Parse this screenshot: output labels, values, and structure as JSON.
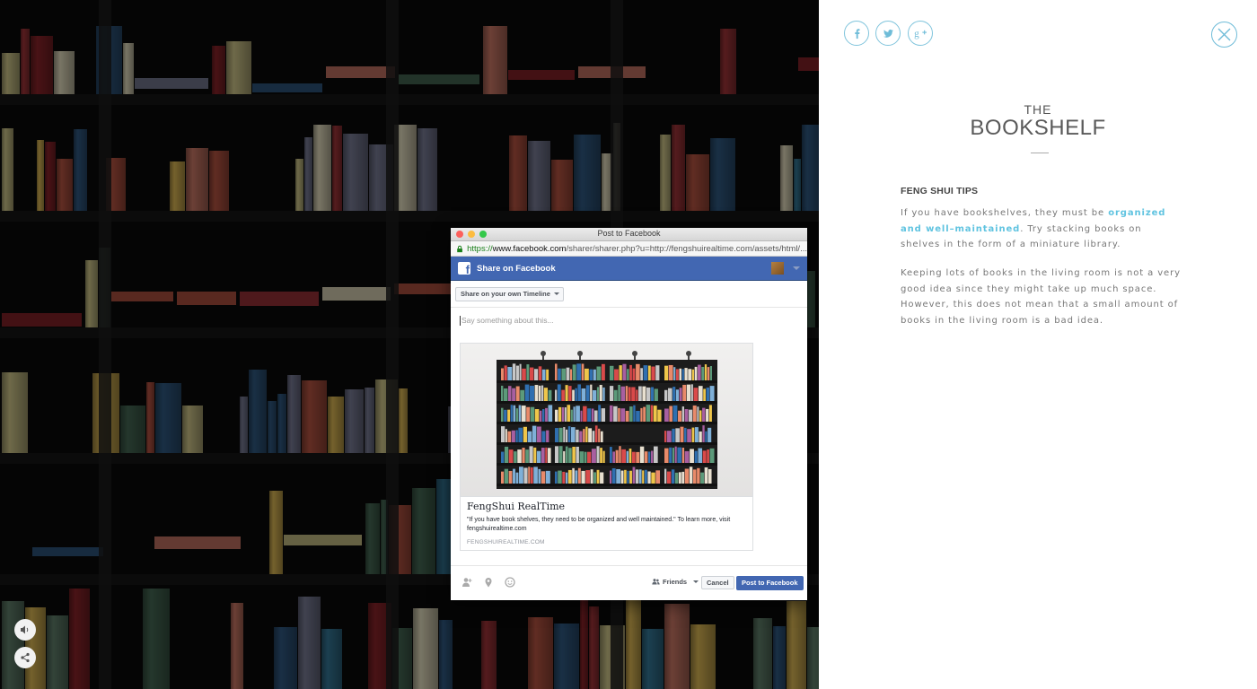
{
  "scene": {
    "controls": [
      {
        "name": "sound-icon"
      },
      {
        "name": "share-icon"
      }
    ]
  },
  "popup": {
    "window_title": "Post to Facebook",
    "url_secure": "https://",
    "url_domain": "www.facebook.com",
    "url_rest": "/sharer/sharer.php?u=http://fengshuirealtime.com/assets/html/...",
    "header_title": "Share on Facebook",
    "share_target": "Share on your own Timeline",
    "compose_placeholder": "Say something about this...",
    "card": {
      "title": "FengShui RealTime",
      "description": "\"If you have book shelves, they need to be organized and well maintained.\" To learn more, visit fengshuirealtime.com",
      "domain": "FENGSHUIREALTIME.COM"
    },
    "audience": "Friends",
    "cancel_label": "Cancel",
    "post_label": "Post to Facebook"
  },
  "panel": {
    "social": [
      {
        "name": "facebook-icon",
        "glyph": "f"
      },
      {
        "name": "twitter-icon",
        "glyph": "t"
      },
      {
        "name": "google-plus-icon",
        "glyph": "g+"
      }
    ],
    "kicker": "THE",
    "title": "BOOKSHELF",
    "section_heading": "FENG SHUI TIPS",
    "para1_pre": "If you have bookshelves, they must be ",
    "para1_highlight": "organized and well–maintained",
    "para1_post": ". Try stacking books on shelves in the form of a miniature library.",
    "para2": "Keeping lots of books in the living room is not a very good idea since they might take up much space. However, this does not mean that a small amount of books in the living room is a bad idea."
  },
  "colors": {
    "facebook_blue": "#4267b2",
    "accent_cyan": "#5fc3e0"
  }
}
